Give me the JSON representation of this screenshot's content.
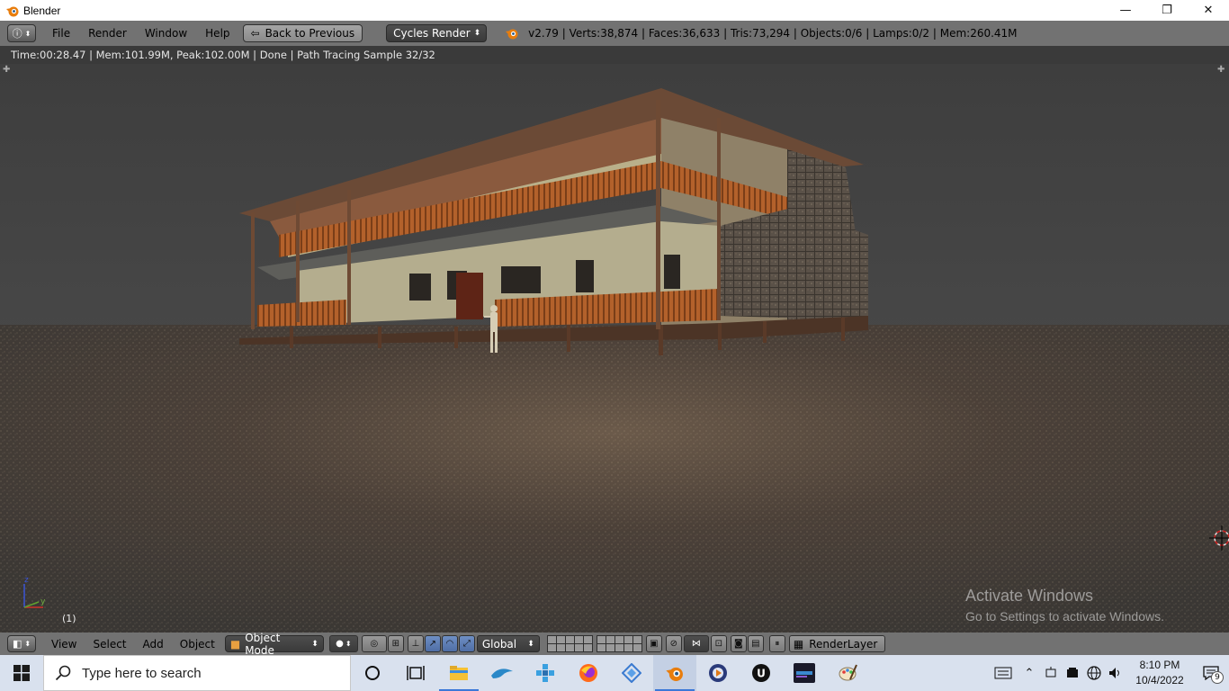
{
  "window": {
    "title": "Blender",
    "minimize_glyph": "—",
    "maximize_glyph": "❐",
    "close_glyph": "✕"
  },
  "info_header": {
    "editor_icon": "info-icon",
    "menus": [
      "File",
      "Render",
      "Window",
      "Help"
    ],
    "back_button": "Back to Previous",
    "render_engine": "Cycles Render",
    "stats": "v2.79 | Verts:38,874 | Faces:36,633 | Tris:73,294 | Objects:0/6 | Lamps:0/2 | Mem:260.41M"
  },
  "render_status": "Time:00:28.47 | Mem:101.99M, Peak:102.00M | Done | Path Tracing Sample 32/32",
  "viewport": {
    "frame_number": "(1)",
    "axis_z": "z",
    "axis_y": "y",
    "watermark_title": "Activate Windows",
    "watermark_sub": "Go to Settings to activate Windows."
  },
  "view_header": {
    "menus": [
      "View",
      "Select",
      "Add",
      "Object"
    ],
    "mode": "Object Mode",
    "orientation": "Global",
    "render_layer": "RenderLayer"
  },
  "taskbar": {
    "search_placeholder": "Type here to search",
    "time": "8:10 PM",
    "date": "10/4/2022",
    "notification_count": "9",
    "apps": [
      "cortana-icon",
      "task-view-icon",
      "file-explorer-icon",
      "dolphin-icon",
      "network-app-icon",
      "firefox-icon",
      "app-icon",
      "blender-icon",
      "media-app-icon",
      "unreal-engine-icon",
      "epic-games-icon",
      "paint-icon"
    ]
  },
  "colors": {
    "blender_header": "#727272",
    "viewport_bg": "#3e3e3e",
    "taskbar_bg": "#d9e1ee",
    "accent_blue": "#3b78d8"
  }
}
